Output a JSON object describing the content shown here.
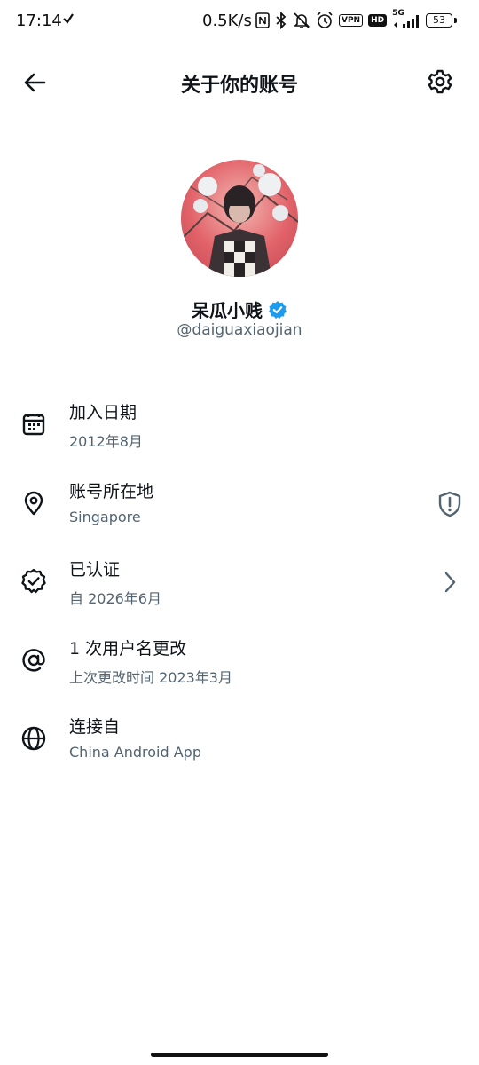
{
  "status_bar": {
    "time": "17:14",
    "network_speed": "0.5K/s",
    "vpn_badge": "VPN",
    "hd_badge": "HD",
    "signal_type": "5G",
    "battery_level": "53"
  },
  "header": {
    "title": "关于你的账号",
    "back_icon": "arrow-left-icon",
    "settings_icon": "gear-icon"
  },
  "profile": {
    "display_name": "呆瓜小贱",
    "handle": "@daiguaxiaojian",
    "verified_badge_color": "#1d9bf0"
  },
  "info_rows": [
    {
      "label": "加入日期",
      "value": "2012年8月",
      "icon": "calendar-icon"
    },
    {
      "label": "账号所在地",
      "value": "Singapore",
      "icon": "location-pin-icon",
      "trailing_icon": "shield-alert-icon"
    },
    {
      "label": "已认证",
      "value": "自 2026年6月",
      "icon": "verified-badge-icon",
      "trailing_icon": "chevron-right-icon"
    },
    {
      "label": "1 次用户名更改",
      "value": "上次更改时间 2023年3月",
      "icon": "at-sign-icon"
    },
    {
      "label": "连接自",
      "value": "China Android App",
      "icon": "globe-icon"
    }
  ],
  "colors": {
    "text_primary": "#0f1419",
    "text_secondary": "#536471",
    "verified_blue": "#1d9bf0"
  }
}
